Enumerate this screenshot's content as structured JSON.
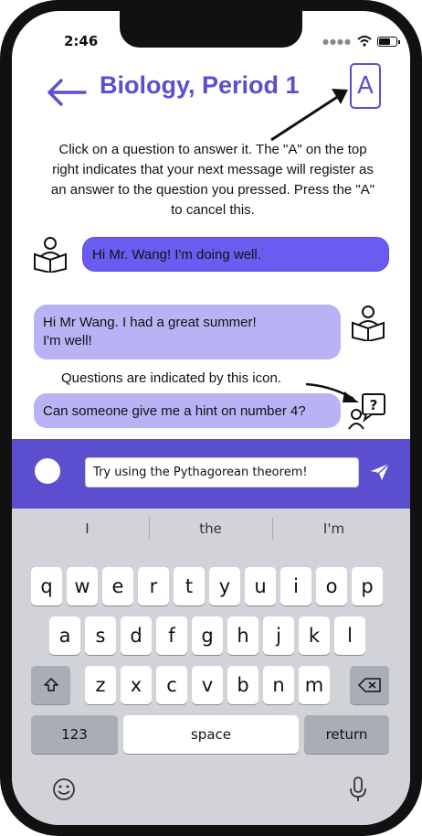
{
  "status_bar": {
    "time": "2:46"
  },
  "header": {
    "title": "Biology, Period 1",
    "answer_mode_label": "A"
  },
  "instructions": "Click on a question to answer it. The \"A\" on the top right indicates that your next message will register as an answer to the question you pressed. Press the \"A\" to cancel this.",
  "messages": [
    {
      "text": "Hi Mr. Wang! I'm doing well.",
      "side": "right-of-icon"
    },
    {
      "text": "Hi Mr Wang. I had a great summer!\nI'm well!",
      "side": "left-of-icon"
    },
    {
      "text": "Can someone give me a hint on number 4?",
      "type": "question"
    }
  ],
  "question_hint": "Questions are indicated by this icon.",
  "composer": {
    "value": "Try using the Pythagorean theorem!"
  },
  "keyboard": {
    "suggestions": [
      "I",
      "the",
      "I'm"
    ],
    "row1": [
      "q",
      "w",
      "e",
      "r",
      "t",
      "y",
      "u",
      "i",
      "o",
      "p"
    ],
    "row2": [
      "a",
      "s",
      "d",
      "f",
      "g",
      "h",
      "j",
      "k",
      "l"
    ],
    "row3": [
      "z",
      "x",
      "c",
      "v",
      "b",
      "n",
      "m"
    ],
    "numbers_label": "123",
    "space_label": "space",
    "return_label": "return"
  },
  "colors": {
    "accent": "#5b4fcf",
    "bubble_sent": "#6a5cf0",
    "bubble_received": "#b9b3f6"
  },
  "icons": [
    "back-arrow-icon",
    "reader-icon",
    "question-icon",
    "send-icon",
    "emoji-icon",
    "microphone-icon",
    "shift-icon",
    "backspace-icon"
  ]
}
